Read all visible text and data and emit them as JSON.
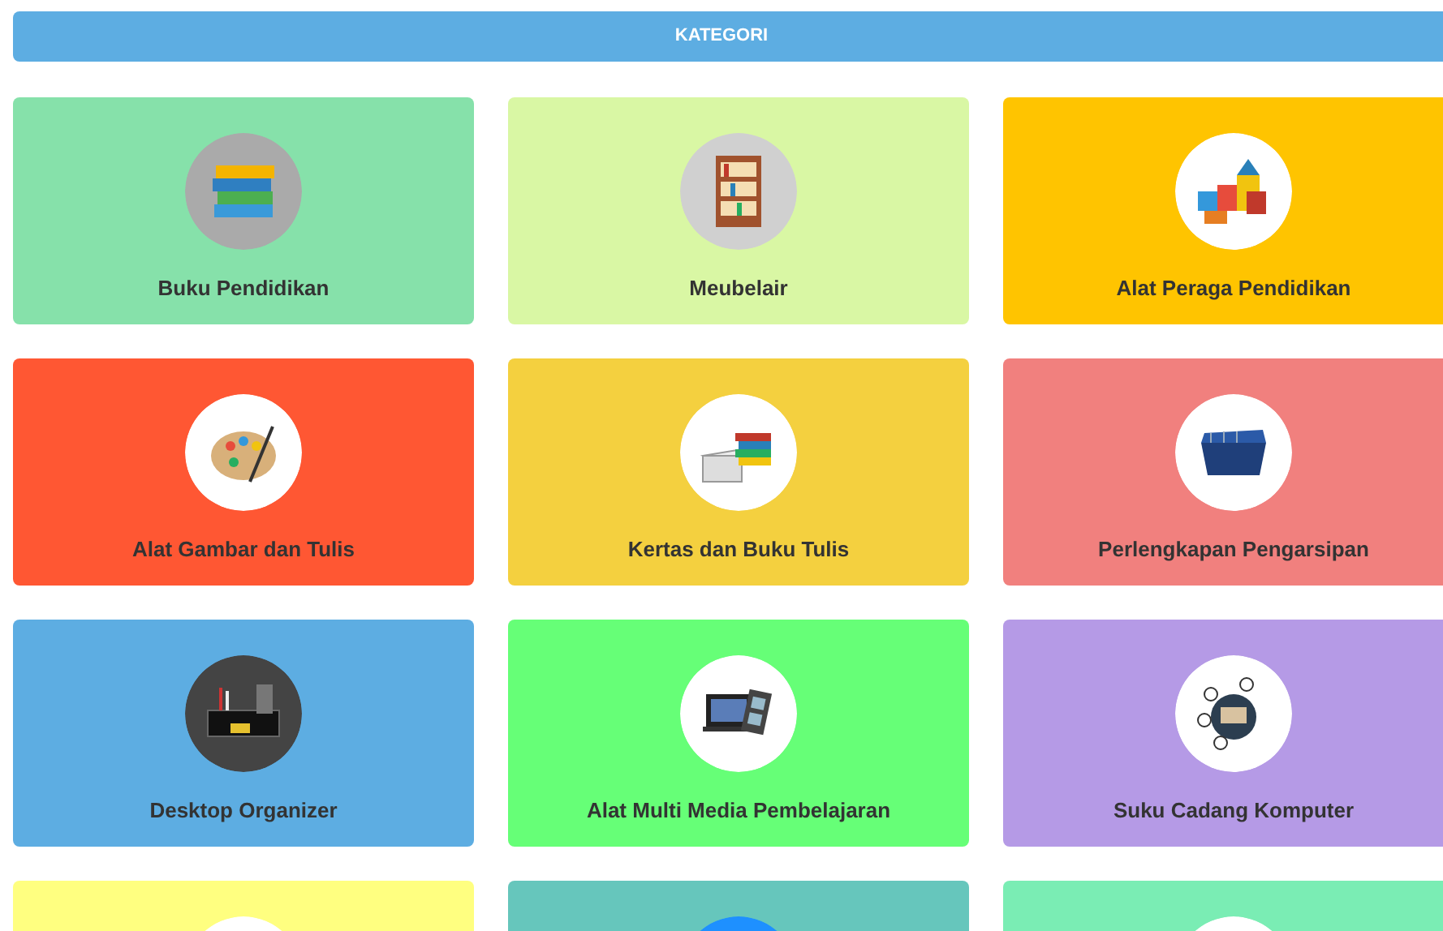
{
  "header": {
    "title": "KATEGORI"
  },
  "categories": [
    {
      "label": "Buku Pendidikan",
      "color": "#86e1aa"
    },
    {
      "label": "Meubelair",
      "color": "#d9f7a4"
    },
    {
      "label": "Alat Peraga Pendidikan",
      "color": "#ffc400"
    },
    {
      "label": "Alat Gambar dan Tulis",
      "color": "#ff5733"
    },
    {
      "label": "Kertas dan Buku Tulis",
      "color": "#f4d03f"
    },
    {
      "label": "Perlengkapan Pengarsipan",
      "color": "#f1807e"
    },
    {
      "label": "Desktop Organizer",
      "color": "#5dade2"
    },
    {
      "label": "Alat Multi Media Pembelajaran",
      "color": "#66ff77"
    },
    {
      "label": "Suku Cadang Komputer",
      "color": "#b59ae6"
    },
    {
      "color": "#ffff80"
    },
    {
      "color": "#66c6bc"
    },
    {
      "color": "#7aedb4"
    }
  ]
}
